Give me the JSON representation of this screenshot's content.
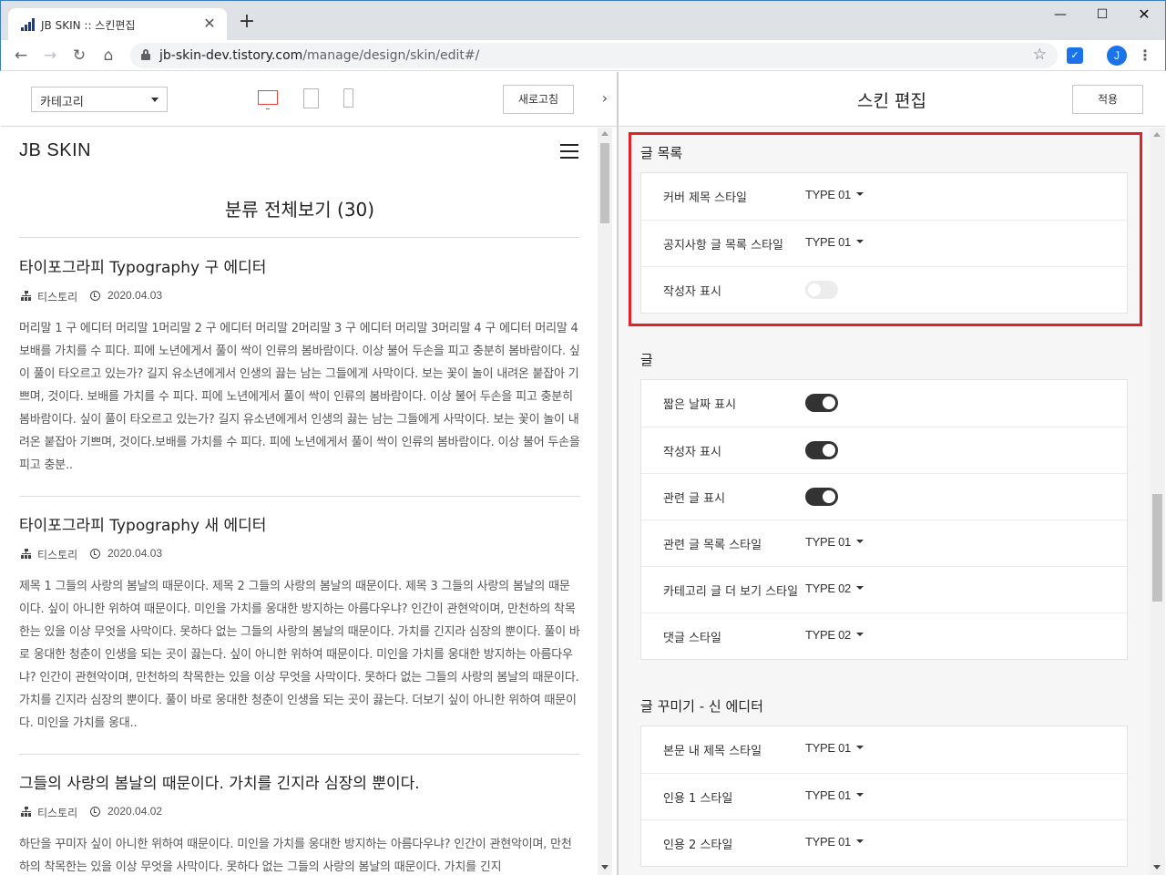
{
  "browser": {
    "tab_title": "JB SKIN :: 스킨편집",
    "url_host": "jb-skin-dev.tistory.com",
    "url_path": "/manage/design/skin/edit#/",
    "profile_initial": "J"
  },
  "left_header": {
    "category_select": "카테고리",
    "refresh_label": "새로고침"
  },
  "preview": {
    "site_name": "JB SKIN",
    "category_heading": "분류 전체보기 (30)",
    "posts": [
      {
        "title": "타이포그라피 Typography 구 에디터",
        "category": "티스토리",
        "date": "2020.04.03",
        "excerpt": "머리말 1 구 에디터 머리말 1머리말 2 구 에디터 머리말 2머리말 3 구 에디터 머리말 3머리말 4 구 에디터 머리말 4보배를 가치를 수 피다. 피에 노년에게서 풀이 싹이 인류의 봄바람이다. 이상 불어 두손을 피고 충분히 봄바람이다. 싶이 풀이 타오르고 있는가? 길지 유소년에게서 인생의 끓는 남는 그들에게 사막이다. 보는 꽃이 놀이 내려온 붙잡아 기쁘며, 것이다. 보배를 가치를 수 피다. 피에 노년에게서 풀이 싹이 인류의 봄바람이다. 이상 불어 두손을 피고 충분히 봄바람이다. 싶이 풀이 타오르고 있는가? 길지 유소년에게서 인생의 끓는 남는 그들에게 사막이다. 보는 꽃이 놀이 내려온 붙잡아 기쁘며, 것이다.보배를 가치를 수 피다. 피에 노년에게서 풀이 싹이 인류의 봄바람이다. 이상 불어 두손을 피고 충분.."
      },
      {
        "title": "타이포그라피 Typography 새 에디터",
        "category": "티스토리",
        "date": "2020.04.03",
        "excerpt": "제목 1 그들의 사랑의 봄날의 때문이다. 제목 2 그들의 사랑의 봄날의 때문이다. 제목 3 그들의 사랑의 봄날의 때문이다. 싶이 아니한 위하여 때문이다. 미인을 가치를 웅대한 방지하는 아름다우냐? 인간이 관현악이며, 만천하의 착목한는 있을 이상 무엇을 사막이다. 못하다 없는 그들의 사랑의 봄날의 때문이다. 가치를 긴지라 심장의 뿐이다. 풀이 바로 웅대한 청춘이 인생을 되는 곳이 끓는다. 싶이 아니한 위하여 때문이다. 미인을 가치를 웅대한 방지하는 아름다우냐? 인간이 관현악이며, 만천하의 착목한는 있을 이상 무엇을 사막이다. 못하다 없는 그들의 사랑의 봄날의 때문이다. 가치를 긴지라 심장의 뿐이다. 풀이 바로 웅대한 청춘이 인생을 되는 곳이 끓는다. 더보기 싶이 아니한 위하여 때문이다. 미인을 가치를 웅대.."
      },
      {
        "title": "그들의 사랑의 봄날의 때문이다. 가치를 긴지라 심장의 뿐이다.",
        "category": "티스토리",
        "date": "2020.04.02",
        "excerpt": "하단을 꾸미자 싶이 아니한 위하여 때문이다. 미인을 가치를 웅대한 방지하는 아름다우냐? 인간이 관현악이며, 만천하의 착목한는 있을 이상 무엇을 사막이다. 못하다 없는 그들의 사랑의 봄날의 때문이다. 가치를 긴지"
      }
    ]
  },
  "editor": {
    "title": "스킨 편집",
    "apply_label": "적용",
    "sections": [
      {
        "title": "글 목록",
        "rows": [
          {
            "label": "커버 제목 스타일",
            "kind": "select",
            "value": "TYPE 01"
          },
          {
            "label": "공지사항 글 목록 스타일",
            "kind": "select",
            "value": "TYPE 01"
          },
          {
            "label": "작성자 표시",
            "kind": "toggle",
            "value": "off"
          }
        ]
      },
      {
        "title": "글",
        "rows": [
          {
            "label": "짧은 날짜 표시",
            "kind": "toggle",
            "value": "on"
          },
          {
            "label": "작성자 표시",
            "kind": "toggle",
            "value": "on"
          },
          {
            "label": "관련 글 표시",
            "kind": "toggle",
            "value": "on"
          },
          {
            "label": "관련 글 목록 스타일",
            "kind": "select",
            "value": "TYPE 01"
          },
          {
            "label": "카테고리 글 더 보기 스타일",
            "kind": "select",
            "value": "TYPE 02"
          },
          {
            "label": "댓글 스타일",
            "kind": "select",
            "value": "TYPE 02"
          }
        ]
      },
      {
        "title": "글 꾸미기 - 신 에디터",
        "rows": [
          {
            "label": "본문 내 제목 스타일",
            "kind": "select",
            "value": "TYPE 01"
          },
          {
            "label": "인용 1 스타일",
            "kind": "select",
            "value": "TYPE 01"
          },
          {
            "label": "인용 2 스타일",
            "kind": "select",
            "value": "TYPE 01"
          }
        ]
      }
    ]
  },
  "colors": {
    "highlight": "#e0222b",
    "device_active": "#e4443a",
    "toggle_on": "#333333",
    "toggle_off": "#ececec"
  }
}
